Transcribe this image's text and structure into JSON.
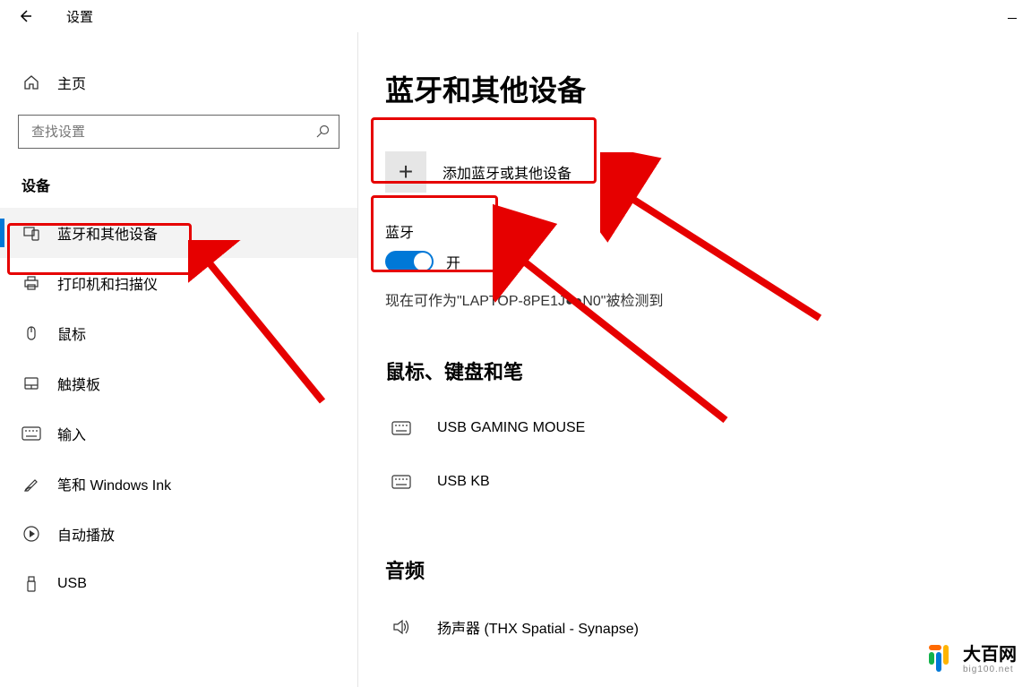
{
  "title": "设置",
  "home_label": "主页",
  "search_placeholder": "查找设置",
  "section_label": "设备",
  "nav": [
    {
      "id": "bluetooth",
      "label": "蓝牙和其他设备",
      "active": true,
      "icon": "devices"
    },
    {
      "id": "printers",
      "label": "打印机和扫描仪",
      "active": false,
      "icon": "printer"
    },
    {
      "id": "mouse",
      "label": "鼠标",
      "active": false,
      "icon": "mouse"
    },
    {
      "id": "touchpad",
      "label": "触摸板",
      "active": false,
      "icon": "touchpad"
    },
    {
      "id": "typing",
      "label": "输入",
      "active": false,
      "icon": "keyboard"
    },
    {
      "id": "pen",
      "label": "笔和 Windows Ink",
      "active": false,
      "icon": "pen"
    },
    {
      "id": "autoplay",
      "label": "自动播放",
      "active": false,
      "icon": "play"
    },
    {
      "id": "usb",
      "label": "USB",
      "active": false,
      "icon": "usb"
    }
  ],
  "content": {
    "heading": "蓝牙和其他设备",
    "add_device_label": "添加蓝牙或其他设备",
    "bt_subhead": "蓝牙",
    "toggle_state_label": "开",
    "status_text": "现在可作为\"LAPTOP-8PE1J●●N0\"被检测到",
    "categories": [
      {
        "title": "鼠标、键盘和笔",
        "devices": [
          {
            "name": "USB GAMING MOUSE",
            "icon": "keyboard"
          },
          {
            "name": "USB KB",
            "icon": "keyboard"
          }
        ]
      },
      {
        "title": "音频",
        "devices": [
          {
            "name": "扬声器 (THX Spatial - Synapse)",
            "icon": "speaker"
          }
        ]
      }
    ]
  },
  "watermark": {
    "main": "大百网",
    "sub": "big100.net"
  }
}
